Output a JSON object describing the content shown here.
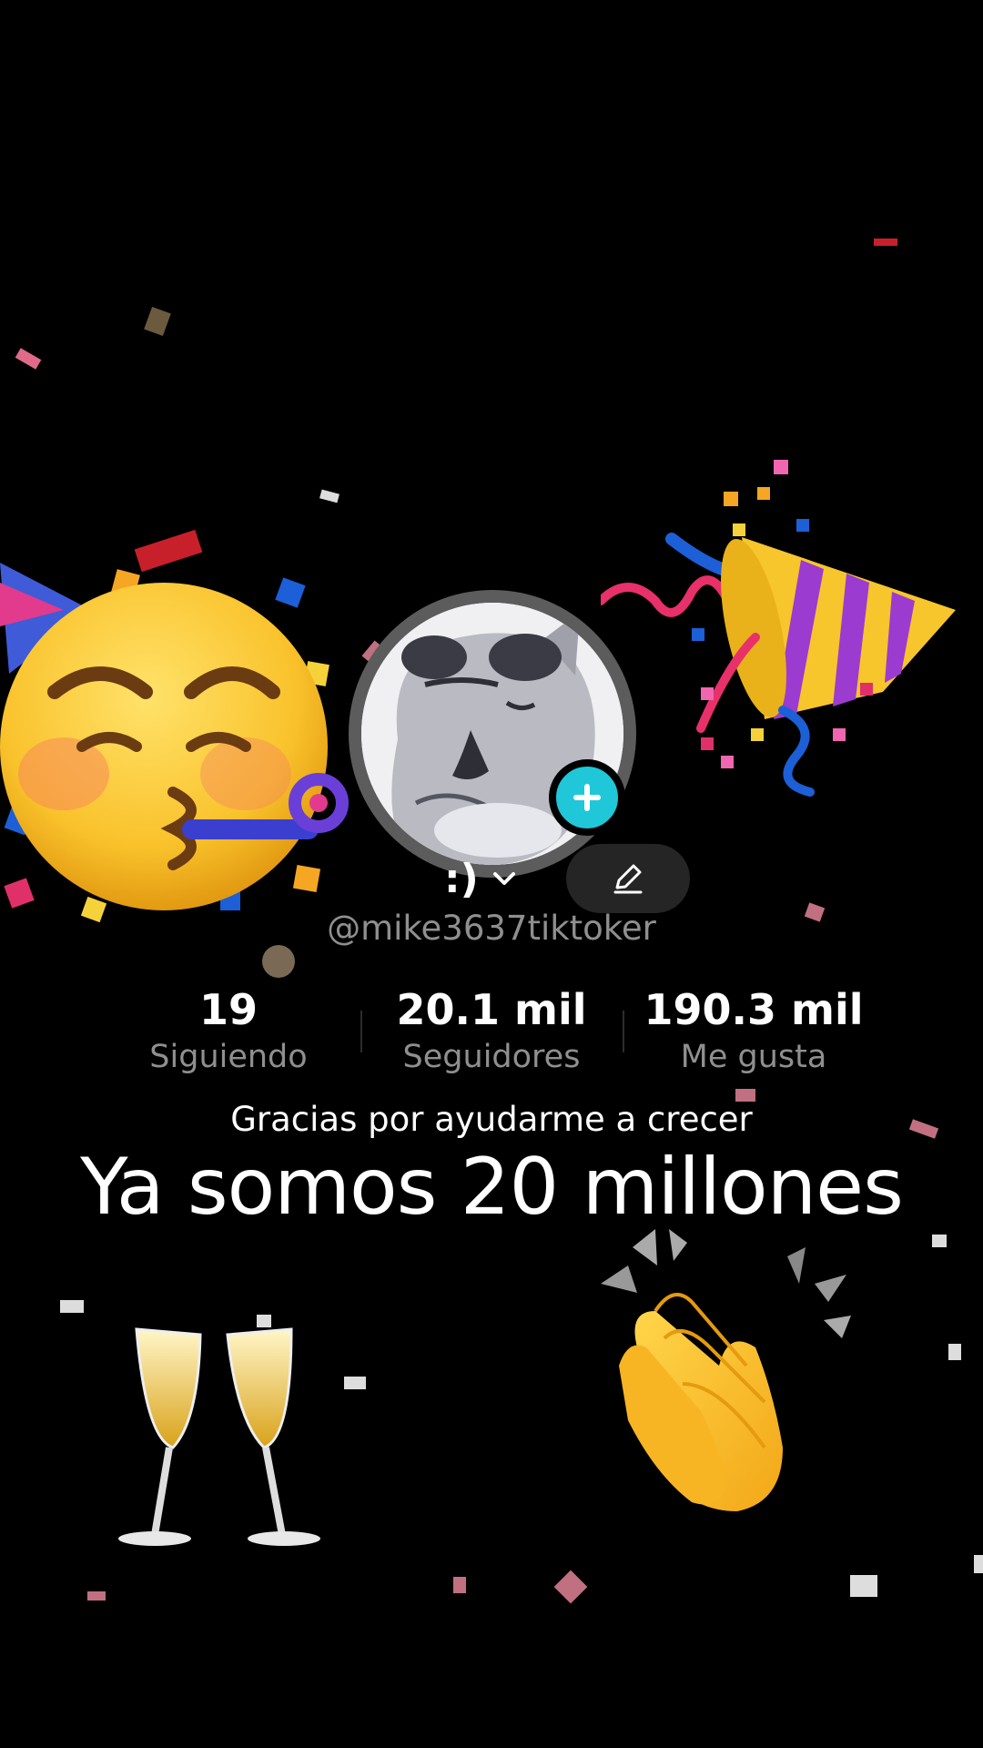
{
  "profile": {
    "display_name": ":)",
    "username": "@mike3637tiktoker"
  },
  "stats": [
    {
      "value": "19",
      "label": "Siguiendo"
    },
    {
      "value": "20.1 mil",
      "label": "Seguidores"
    },
    {
      "value": "190.3 mil",
      "label": "Me gusta"
    }
  ],
  "overlay": {
    "subtitle": "Gracias por ayudarme a crecer",
    "headline": "Ya somos 20 millones"
  },
  "icons": {
    "party_face": "partying-face-icon",
    "party_popper": "party-popper-icon",
    "champagne": "clinking-glasses-icon",
    "clapping": "clapping-hands-icon",
    "add": "plus-icon",
    "edit": "pencil-icon",
    "chevron": "chevron-down-icon"
  },
  "colors": {
    "background": "#000000",
    "accent_badge": "#1fc7d8",
    "muted_text": "#8f8f8f",
    "edit_button": "#252525"
  }
}
